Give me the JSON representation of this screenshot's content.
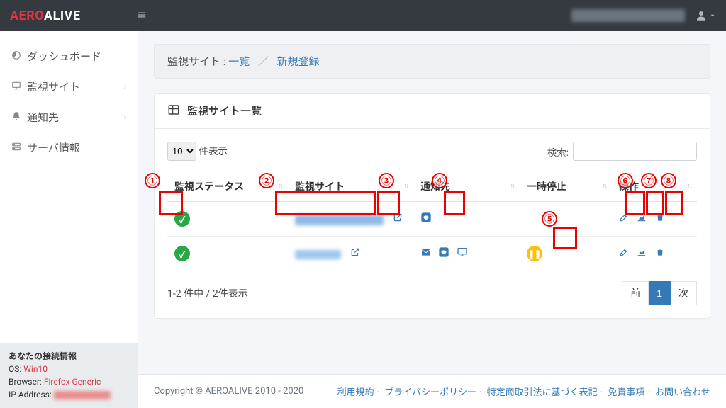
{
  "brand": {
    "part1": "AERO",
    "part2": "ALIVE"
  },
  "sidebar": {
    "items": [
      {
        "icon": "gauge",
        "label": "ダッシュボード",
        "expandable": false
      },
      {
        "icon": "monitor",
        "label": "監視サイト",
        "expandable": true
      },
      {
        "icon": "bell",
        "label": "通知先",
        "expandable": true
      },
      {
        "icon": "server",
        "label": "サーバ情報",
        "expandable": false
      }
    ]
  },
  "conn_info": {
    "title": "あなたの接続情報",
    "os_label": "OS:",
    "os_value": "Win10",
    "browser_label": "Browser:",
    "browser_value": "Firefox Generic",
    "ip_label": "IP Address:"
  },
  "breadcrumb": {
    "root": "監視サイト :",
    "current": "一覧",
    "next": "新規登録"
  },
  "card": {
    "title": "監視サイト一覧",
    "length_suffix": "件表示",
    "length_value": "10",
    "search_label": "検索:",
    "columns": {
      "status": "監視ステータス",
      "site": "監視サイト",
      "notify": "通知先",
      "pause": "一時停止",
      "action": "操作"
    },
    "rows": [
      {
        "status": "ok",
        "notify": [
          "line"
        ],
        "pause": null
      },
      {
        "status": "ok",
        "notify": [
          "mail",
          "line",
          "monitor"
        ],
        "pause": "paused"
      }
    ],
    "info": "1-2 件中 / 2件表示",
    "pager": {
      "prev": "前",
      "page": "1",
      "next": "次"
    }
  },
  "footer": {
    "copyright": "Copyright © AEROALIVE 2010 - 2020",
    "links": [
      "利用規約",
      "プライバシーポリシー",
      "特定商取引法に基づく表記",
      "免責事項",
      "お問い合わせ"
    ]
  },
  "annotations": [
    "①",
    "②",
    "③",
    "④",
    "⑤",
    "⑥",
    "⑦",
    "⑧"
  ]
}
